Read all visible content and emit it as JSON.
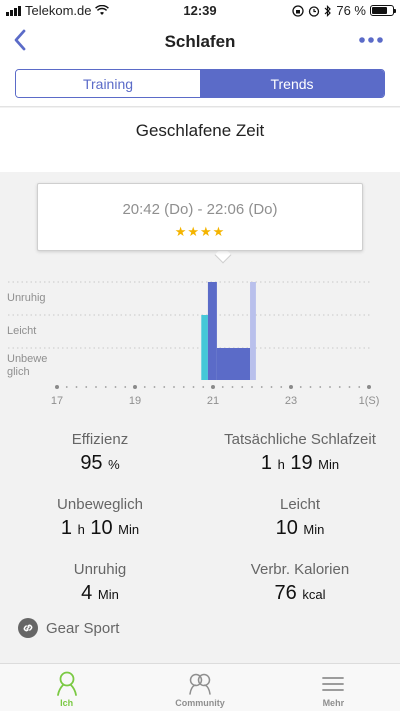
{
  "status_bar": {
    "carrier": "Telekom.de",
    "time": "12:39",
    "battery": "76 %",
    "battery_level": 0.76
  },
  "nav": {
    "title": "Schlafen",
    "back_icon": "chevron-left-icon",
    "more_icon": "more-dots-icon"
  },
  "tabs": [
    {
      "label": "Training",
      "active": false
    },
    {
      "label": "Trends",
      "active": true
    }
  ],
  "section_title": "Geschlafene Zeit",
  "tooltip": {
    "time_range": "20:42 (Do) - 22:06 (Do)",
    "stars": "★★★★",
    "rating": 4
  },
  "chart_data": {
    "type": "bar",
    "levels": [
      "Unruhig",
      "Leicht",
      "Unbewe glich"
    ],
    "level_labels": [
      "Unruhig",
      "Leicht",
      "Unbewe",
      "glich"
    ],
    "x_ticks": [
      "17",
      "19",
      "21",
      "23",
      "1(S)"
    ],
    "x_tick_values": [
      17,
      19,
      21,
      23,
      25
    ],
    "xlim": [
      17,
      25
    ],
    "segments": [
      {
        "start": 20.7,
        "end": 20.87,
        "level": "Leicht",
        "color": "#45c8d8"
      },
      {
        "start": 20.87,
        "end": 21.1,
        "level": "Unruhig",
        "color": "#5b6bc8"
      },
      {
        "start": 21.1,
        "end": 21.95,
        "level": "Unbewe glich",
        "color": "#5b6bc8"
      },
      {
        "start": 21.95,
        "end": 22.1,
        "level": "Unruhig",
        "color": "#b9c0ec"
      }
    ],
    "grid": true
  },
  "stats": {
    "efficiency": {
      "label": "Effizienz",
      "value": "95",
      "unit": "%"
    },
    "actual_sleep": {
      "label": "Tatsächliche Schlafzeit",
      "h_value": "1",
      "h_unit": "h",
      "m_value": "19",
      "m_unit": "Min"
    },
    "motionless": {
      "label": "Unbeweglich",
      "h_value": "1",
      "h_unit": "h",
      "m_value": "10",
      "m_unit": "Min"
    },
    "light": {
      "label": "Leicht",
      "value": "10",
      "unit": "Min"
    },
    "restless": {
      "label": "Unruhig",
      "value": "4",
      "unit": "Min"
    },
    "calories": {
      "label": "Verbr. Kalorien",
      "value": "76",
      "unit": "kcal"
    }
  },
  "device": {
    "name": "Gear Sport",
    "icon": "link-icon"
  },
  "tab_bar": [
    {
      "label": "Ich",
      "icon": "person-icon",
      "active": true
    },
    {
      "label": "Community",
      "icon": "community-icon",
      "active": false
    },
    {
      "label": "Mehr",
      "icon": "menu-icon",
      "active": false
    }
  ],
  "colors": {
    "accent": "#5b6bc8",
    "light_sleep": "#45c8d8",
    "restless": "#b9c0ec",
    "tab_active": "#7ac943",
    "star": "#f4b400"
  }
}
